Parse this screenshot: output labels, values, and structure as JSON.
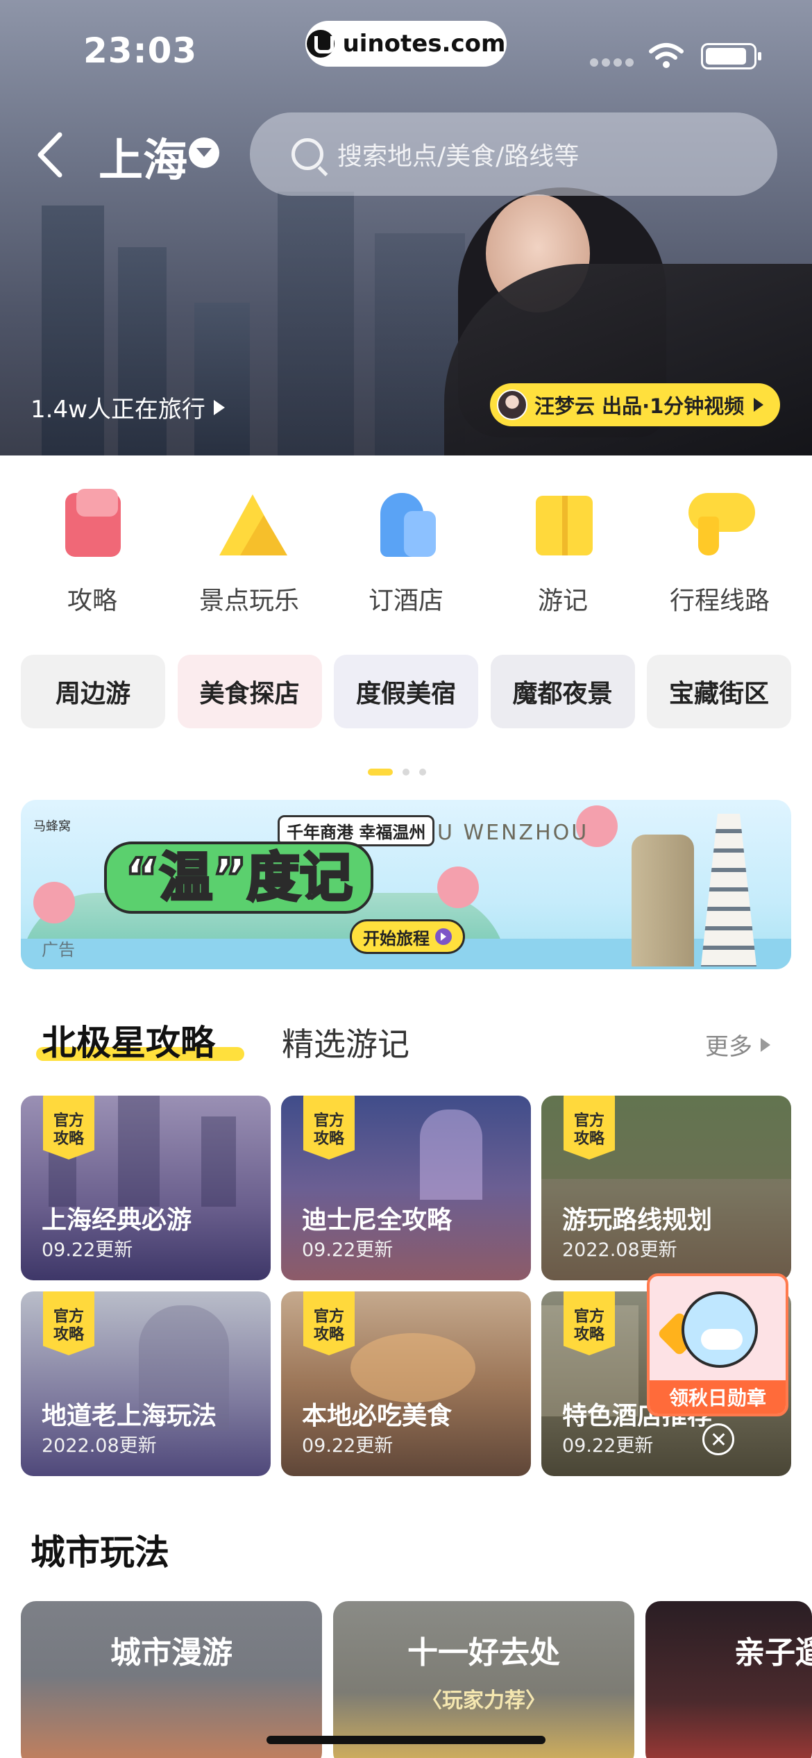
{
  "status_bar": {
    "time": "23:03",
    "watermark": "uinotes.com"
  },
  "header": {
    "city": "上海",
    "search_placeholder": "搜索地点/美食/路线等",
    "travelling": "1.4w人正在旅行",
    "video_pill": "汪梦云 出品·1分钟视频"
  },
  "categories": [
    {
      "label": "攻略",
      "icon": "guide-icon"
    },
    {
      "label": "景点玩乐",
      "icon": "attractions-icon"
    },
    {
      "label": "订酒店",
      "icon": "hotel-icon"
    },
    {
      "label": "游记",
      "icon": "travelogue-icon"
    },
    {
      "label": "行程线路",
      "icon": "route-icon"
    }
  ],
  "chips": [
    {
      "label": "周边游",
      "bg": "#f1f1f1"
    },
    {
      "label": "美食探店",
      "bg": "#fbecee"
    },
    {
      "label": "度假美宿",
      "bg": "#eeeef6"
    },
    {
      "label": "魔都夜景",
      "bg": "#ececf1"
    },
    {
      "label": "宝藏街区",
      "bg": "#f1f1f1"
    }
  ],
  "banner": {
    "sub": "千年商港 幸福温州",
    "wenzhou": "U WENZHOU",
    "title": "“温”度记",
    "button": "开始旅程",
    "ad": "广告",
    "logo": "马蜂窝"
  },
  "section": {
    "tab_active": "北极星攻略",
    "tab_other": "精选游记",
    "more": "更多"
  },
  "badge": {
    "line1": "官方",
    "line2": "攻略"
  },
  "guides": [
    {
      "title": "上海经典必游",
      "date": "09.22更新",
      "cls": "c1"
    },
    {
      "title": "迪士尼全攻略",
      "date": "09.22更新",
      "cls": "c2"
    },
    {
      "title": "游玩路线规划",
      "date": "2022.08更新",
      "cls": "c3"
    },
    {
      "title": "地道老上海玩法",
      "date": "2022.08更新",
      "cls": "c4"
    },
    {
      "title": "本地必吃美食",
      "date": "09.22更新",
      "cls": "c5"
    },
    {
      "title": "特色酒店推荐",
      "date": "09.22更新",
      "cls": "c6"
    }
  ],
  "award": {
    "label": "领秋日勋章"
  },
  "city_play": {
    "title": "城市玩法",
    "items": [
      {
        "label": "城市漫游",
        "sub": ""
      },
      {
        "label": "十一好去处",
        "sub": "〈玩家力荐〉"
      },
      {
        "label": "亲子遛",
        "sub": ""
      }
    ]
  },
  "colors": {
    "accent": "#ffe03d",
    "award": "#ff6b3a"
  }
}
